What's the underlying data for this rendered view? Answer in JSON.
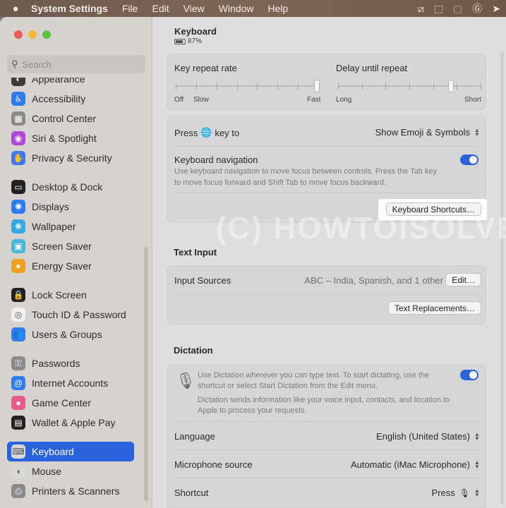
{
  "menubar": {
    "apple": "",
    "app_name": "System Settings",
    "items": [
      "File",
      "Edit",
      "View",
      "Window",
      "Help"
    ],
    "tray_icons": [
      "screenshot-icon",
      "crop-icon",
      "window-icon",
      "grammarly-icon",
      "share-icon"
    ]
  },
  "sidebar": {
    "search_placeholder": "Search",
    "items": [
      {
        "label": "Appearance",
        "color": "#3b3b3b",
        "icon": "◐"
      },
      {
        "label": "Accessibility",
        "color": "#2f7bf0",
        "icon": "♿"
      },
      {
        "label": "Control Center",
        "color": "#8a8a8a",
        "icon": "▦"
      },
      {
        "label": "Siri & Spotlight",
        "color": "#b048d8",
        "icon": "◉"
      },
      {
        "label": "Privacy & Security",
        "color": "#3f7bf0",
        "icon": "✋"
      },
      {
        "label": "Desktop & Dock",
        "color": "#222222",
        "icon": "▭"
      },
      {
        "label": "Displays",
        "color": "#2f7bf0",
        "icon": "✺"
      },
      {
        "label": "Wallpaper",
        "color": "#35a8e8",
        "icon": "❋"
      },
      {
        "label": "Screen Saver",
        "color": "#45b8d8",
        "icon": "▣"
      },
      {
        "label": "Energy Saver",
        "color": "#f0a020",
        "icon": "●"
      },
      {
        "label": "Lock Screen",
        "color": "#222222",
        "icon": "🔒"
      },
      {
        "label": "Touch ID & Password",
        "color": "#f0f0f0",
        "icon": "◎"
      },
      {
        "label": "Users & Groups",
        "color": "#2f7bf0",
        "icon": "👥"
      },
      {
        "label": "Passwords",
        "color": "#8a8a8a",
        "icon": "⚿"
      },
      {
        "label": "Internet Accounts",
        "color": "#2f7bf0",
        "icon": "@"
      },
      {
        "label": "Game Center",
        "color": "#e85a8a",
        "icon": "●"
      },
      {
        "label": "Wallet & Apple Pay",
        "color": "#222222",
        "icon": "▤"
      },
      {
        "label": "Keyboard",
        "color": "#d8d8d8",
        "icon": "⌨"
      },
      {
        "label": "Mouse",
        "color": "#d8d8d8",
        "icon": "◖"
      },
      {
        "label": "Printers & Scanners",
        "color": "#8a8a8a",
        "icon": "⎙"
      }
    ],
    "selected": "Keyboard"
  },
  "header": {
    "title": "Keyboard",
    "battery": "87%",
    "battery_level": 0.87
  },
  "repeat": {
    "key_repeat_label": "Key repeat rate",
    "key_repeat_left": "Off",
    "key_repeat_mid": "Slow",
    "key_repeat_right": "Fast",
    "key_repeat_value": 1.0,
    "delay_label": "Delay until repeat",
    "delay_left": "Long",
    "delay_right": "Short",
    "delay_value": 0.8
  },
  "press_key": {
    "label_before": "Press",
    "label_after": "key to",
    "value": "Show Emoji & Symbols"
  },
  "keyboard_navigation": {
    "label": "Keyboard navigation",
    "description_line1": "Use keyboard navigation to move focus between controls. Press the Tab key",
    "description_line2": "to move focus forward and Shift Tab to move focus backward.",
    "enabled": true,
    "shortcuts_button": "Keyboard Shortcuts…"
  },
  "text_input": {
    "section_title": "Text Input",
    "input_sources_label": "Input Sources",
    "input_sources_value": "ABC – India, Spanish, and 1 other",
    "edit_button": "Edit…",
    "text_replacements_button": "Text Replacements…"
  },
  "dictation": {
    "section_title": "Dictation",
    "description_line1": "Use Dictation wherever you can type text. To start dictating, use the",
    "description_line2": "shortcut or select Start Dictation from the Edit menu.",
    "privacy_line1": "Dictation sends information like your voice input, contacts, and location to",
    "privacy_line2": "Apple to process your requests.",
    "enabled": true,
    "language_label": "Language",
    "language_value": "English (United States)",
    "mic_label": "Microphone source",
    "mic_value": "Automatic (iMac Microphone)",
    "shortcut_label": "Shortcut",
    "shortcut_value": "Press"
  },
  "watermark": "(C) HOWTOISOLVE.COM"
}
